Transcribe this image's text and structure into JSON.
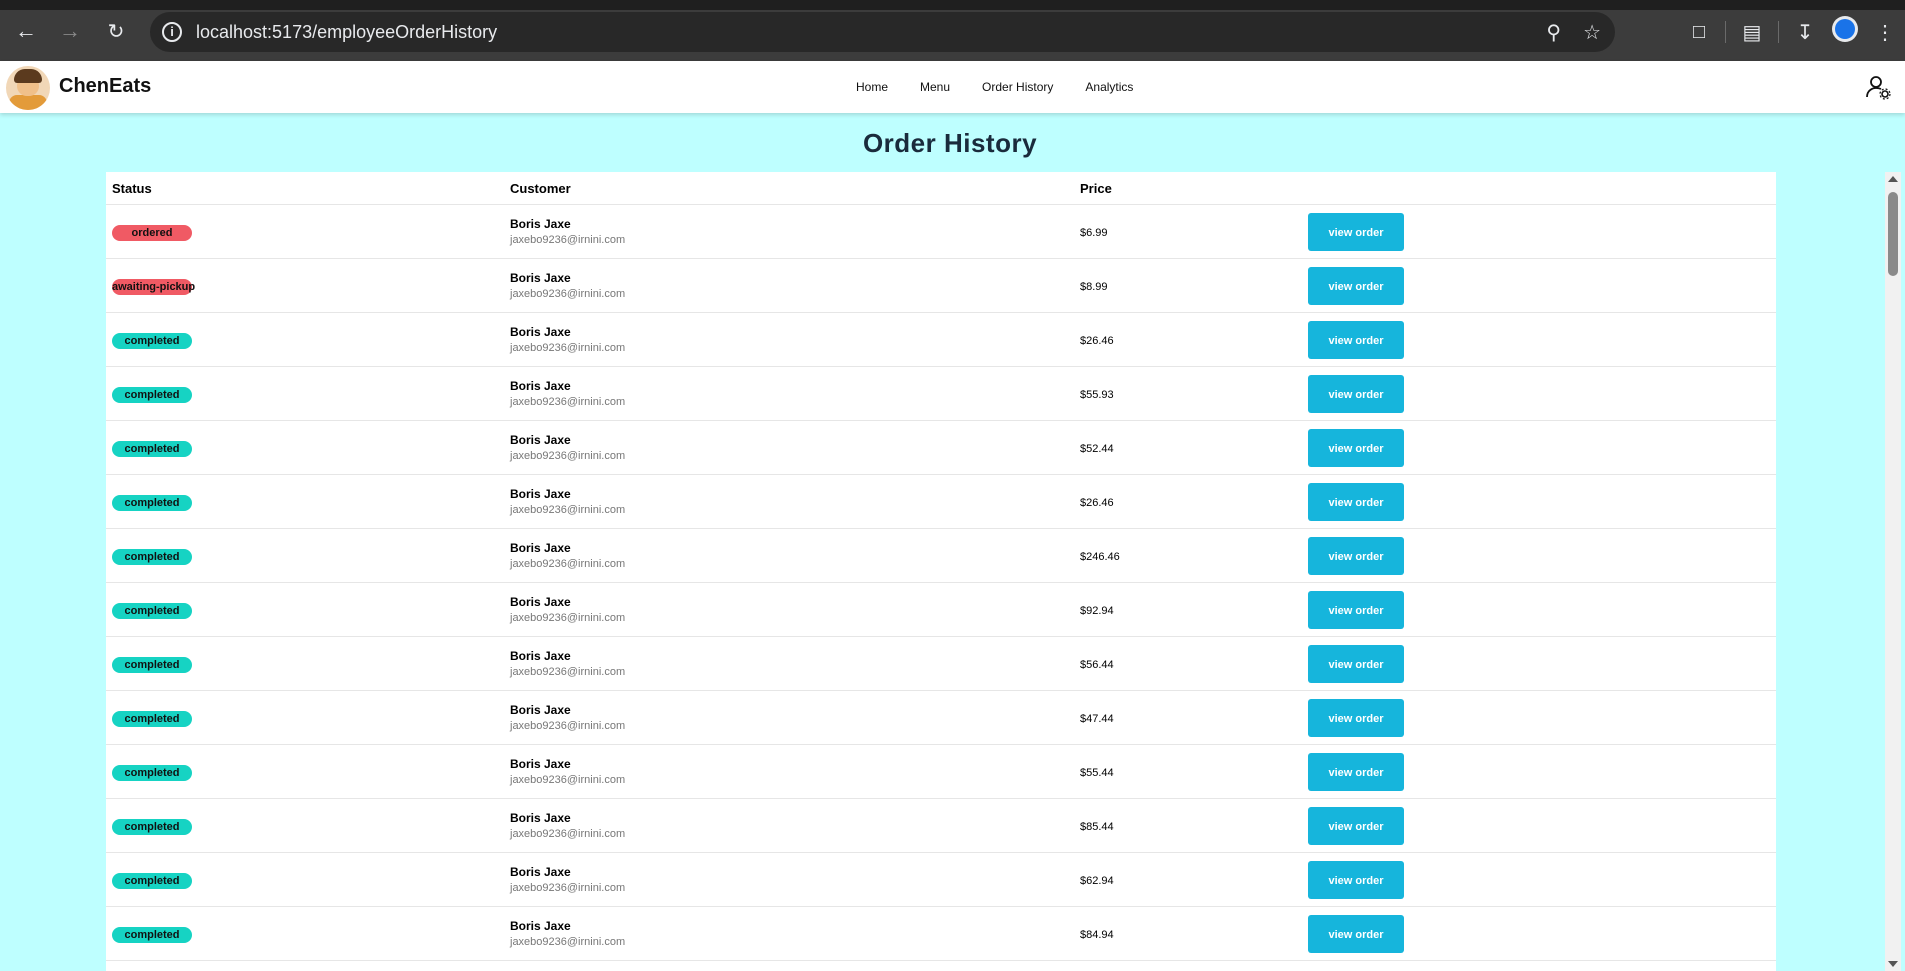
{
  "browser": {
    "url": "localhost:5173/employeeOrderHistory"
  },
  "app": {
    "brand": "ChenEats",
    "nav": [
      "Home",
      "Menu",
      "Order History",
      "Analytics"
    ]
  },
  "page": {
    "title": "Order History"
  },
  "table": {
    "headers": [
      "Status",
      "Customer",
      "Price",
      ""
    ],
    "view_label": "view order",
    "rows": [
      {
        "status": "ordered",
        "status_color": "#f05a64",
        "name": "Boris Jaxe",
        "email": "jaxebo9236@irnini.com",
        "price": "$6.99"
      },
      {
        "status": "awaiting-pickup",
        "status_color": "#f05a64",
        "name": "Boris Jaxe",
        "email": "jaxebo9236@irnini.com",
        "price": "$8.99"
      },
      {
        "status": "completed",
        "status_color": "#16d3c3",
        "name": "Boris Jaxe",
        "email": "jaxebo9236@irnini.com",
        "price": "$26.46"
      },
      {
        "status": "completed",
        "status_color": "#16d3c3",
        "name": "Boris Jaxe",
        "email": "jaxebo9236@irnini.com",
        "price": "$55.93"
      },
      {
        "status": "completed",
        "status_color": "#16d3c3",
        "name": "Boris Jaxe",
        "email": "jaxebo9236@irnini.com",
        "price": "$52.44"
      },
      {
        "status": "completed",
        "status_color": "#16d3c3",
        "name": "Boris Jaxe",
        "email": "jaxebo9236@irnini.com",
        "price": "$26.46"
      },
      {
        "status": "completed",
        "status_color": "#16d3c3",
        "name": "Boris Jaxe",
        "email": "jaxebo9236@irnini.com",
        "price": "$246.46"
      },
      {
        "status": "completed",
        "status_color": "#16d3c3",
        "name": "Boris Jaxe",
        "email": "jaxebo9236@irnini.com",
        "price": "$92.94"
      },
      {
        "status": "completed",
        "status_color": "#16d3c3",
        "name": "Boris Jaxe",
        "email": "jaxebo9236@irnini.com",
        "price": "$56.44"
      },
      {
        "status": "completed",
        "status_color": "#16d3c3",
        "name": "Boris Jaxe",
        "email": "jaxebo9236@irnini.com",
        "price": "$47.44"
      },
      {
        "status": "completed",
        "status_color": "#16d3c3",
        "name": "Boris Jaxe",
        "email": "jaxebo9236@irnini.com",
        "price": "$55.44"
      },
      {
        "status": "completed",
        "status_color": "#16d3c3",
        "name": "Boris Jaxe",
        "email": "jaxebo9236@irnini.com",
        "price": "$85.44"
      },
      {
        "status": "completed",
        "status_color": "#16d3c3",
        "name": "Boris Jaxe",
        "email": "jaxebo9236@irnini.com",
        "price": "$62.94"
      },
      {
        "status": "completed",
        "status_color": "#16d3c3",
        "name": "Boris Jaxe",
        "email": "jaxebo9236@irnini.com",
        "price": "$84.94"
      }
    ]
  },
  "colors": {
    "page_bg": "#beffff",
    "button": "#16b5dc",
    "status_red": "#f05a64",
    "status_teal": "#16d3c3"
  }
}
